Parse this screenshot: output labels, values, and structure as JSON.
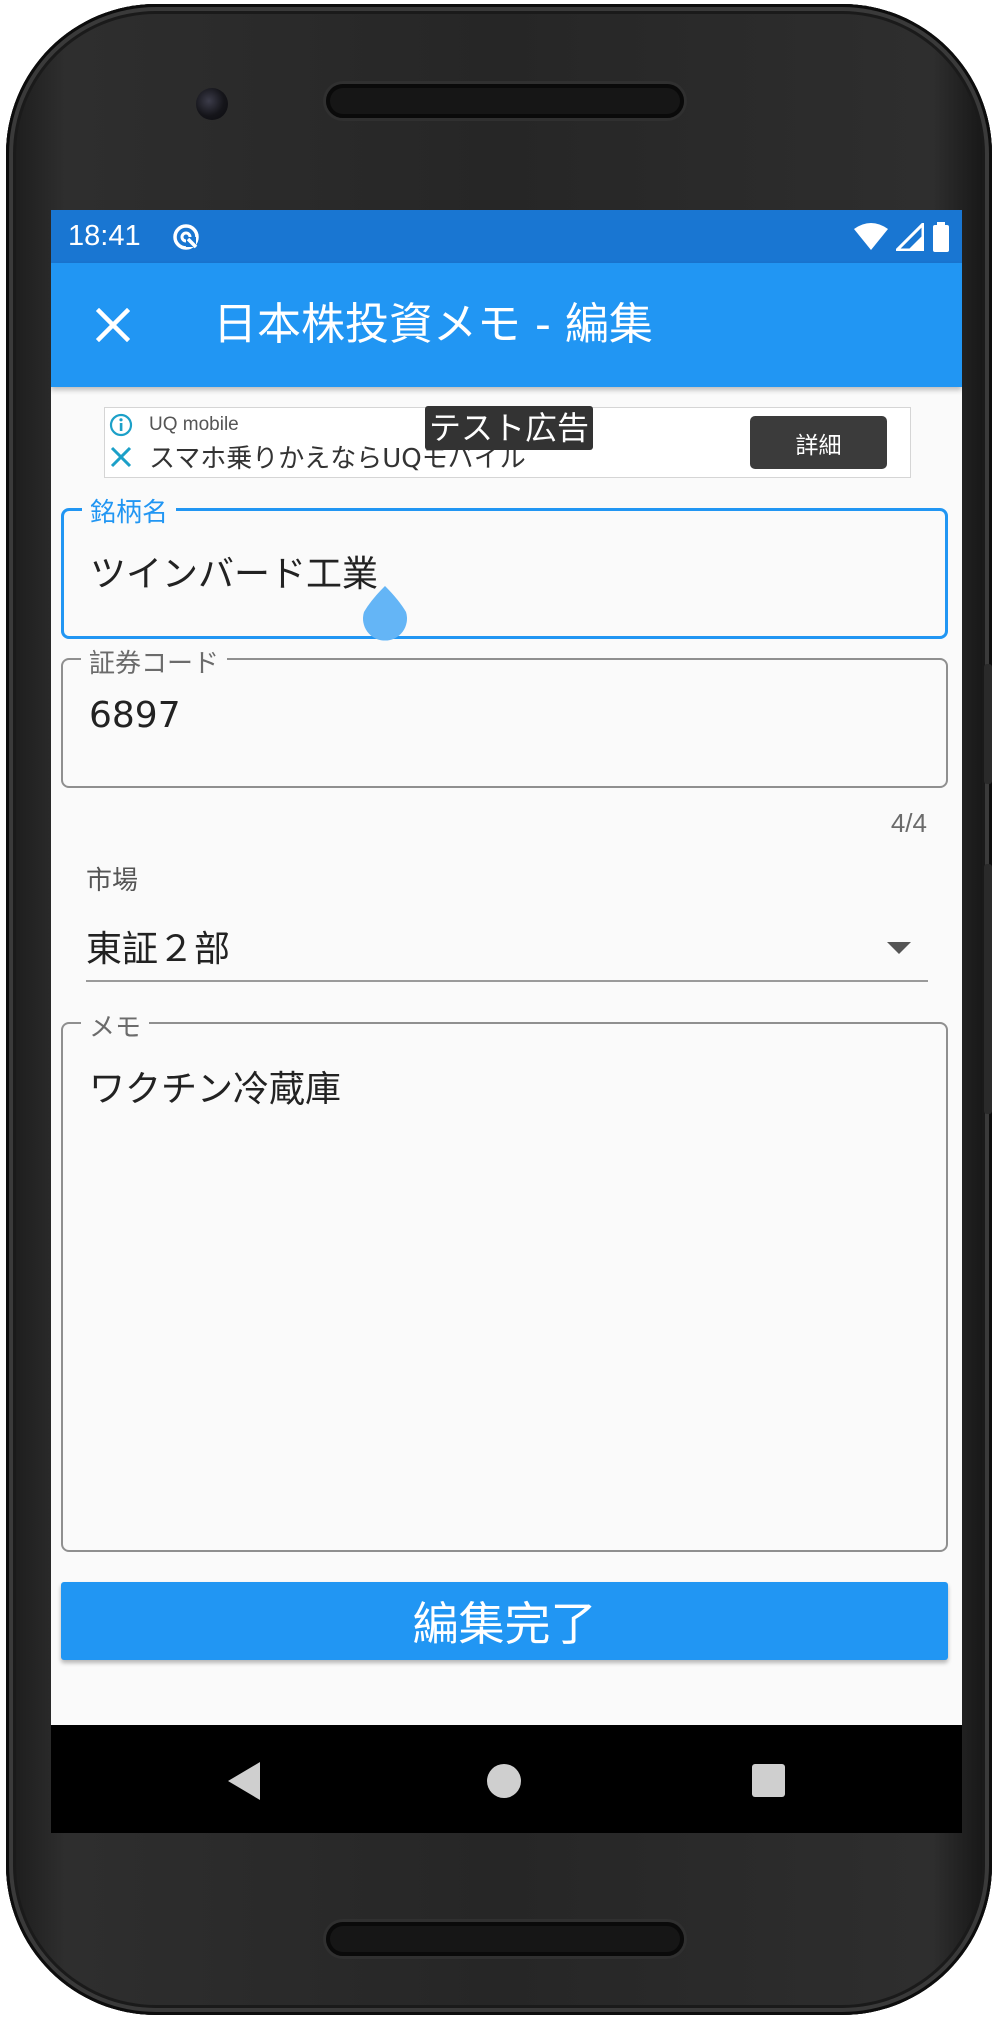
{
  "status_bar": {
    "time": "18:41",
    "icons": [
      "sync-icon",
      "wifi-icon",
      "signal-icon",
      "battery-icon"
    ]
  },
  "app_bar": {
    "title": "日本株投資メモ - 編集",
    "close_icon": "close-icon"
  },
  "ad": {
    "advertiser": "UQ mobile",
    "headline": "スマホ乗りかえならUQモバイル",
    "test_label": "テスト広告",
    "button_label": "詳細"
  },
  "form": {
    "name_field": {
      "label": "銘柄名",
      "value": "ツインバード工業"
    },
    "code_field": {
      "label": "証券コード",
      "value": "6897",
      "counter": "4/4"
    },
    "market_select": {
      "label": "市場",
      "value": "東証２部"
    },
    "memo_field": {
      "label": "メモ",
      "value": "ワクチン冷蔵庫"
    },
    "submit_label": "編集完了"
  },
  "colors": {
    "status_bar": "#1976d2",
    "primary": "#2196f3",
    "background": "#fafafa"
  }
}
